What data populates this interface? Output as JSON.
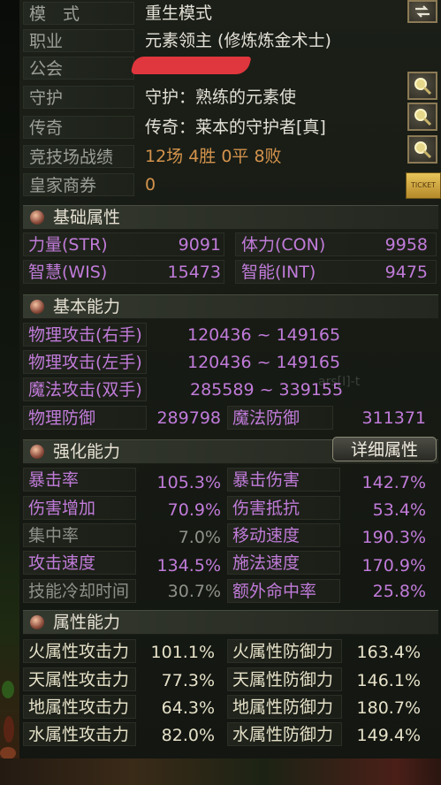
{
  "colors": {
    "label": "#9c9f97",
    "value": "#e3e0d6",
    "orange": "#d4934c",
    "purple": "#c07bd9",
    "header_bg": "#2f342b"
  },
  "info": {
    "rows": [
      {
        "label": "模　式",
        "value": "重生模式",
        "style": "white"
      },
      {
        "label": "职业",
        "value": "元素领主 (修炼炼金术士)",
        "style": "white"
      },
      {
        "label": "公会",
        "value": "",
        "style": "white"
      },
      {
        "label": "守护",
        "value": "守护：熟练的元素使",
        "style": "white"
      },
      {
        "label": "传奇",
        "value": "传奇：莱本的守护者[真]",
        "style": "white"
      },
      {
        "label": "竞技场战绩",
        "value": "12场 4胜 0平 8败",
        "style": "orange"
      },
      {
        "label": "皇家商券",
        "value": "0",
        "style": "orange"
      }
    ],
    "ticket_text": "TICKET"
  },
  "icons": {
    "mode_toggle": "swap-arrows-icon",
    "inspect": "magnifier-icon",
    "section": "orb-icon"
  },
  "basic_attributes": {
    "title": "基础属性",
    "stats": [
      {
        "name": "力量(STR)",
        "value": "9091"
      },
      {
        "name": "体力(CON)",
        "value": "9958"
      },
      {
        "name": "智慧(WIS)",
        "value": "15473"
      },
      {
        "name": "智能(INT)",
        "value": "9475"
      }
    ]
  },
  "basic_abilities": {
    "title": "基本能力",
    "attacks": [
      {
        "name": "物理攻击(右手)",
        "value": "120436 ~ 149165"
      },
      {
        "name": "物理攻击(左手)",
        "value": "120436 ~ 149165"
      },
      {
        "name": "魔法攻击(双手)",
        "value": "285589 ~ 339155"
      }
    ],
    "defense": [
      {
        "name": "物理防御",
        "value": "289798"
      },
      {
        "name": "魔法防御",
        "value": "311371"
      }
    ],
    "ghost_text": "ars[I]-t"
  },
  "enhance": {
    "title": "强化能力",
    "detail_button": "详细属性",
    "stats": [
      {
        "name": "暴击率",
        "value": "105.3%",
        "name_style": "purple"
      },
      {
        "name": "暴击伤害",
        "value": "142.7%",
        "name_style": "purple"
      },
      {
        "name": "伤害增加",
        "value": "70.9%",
        "name_style": "purple"
      },
      {
        "name": "伤害抵抗",
        "value": "53.4%",
        "name_style": "purple"
      },
      {
        "name": "集中率",
        "value": "7.0%",
        "name_style": "gray"
      },
      {
        "name": "移动速度",
        "value": "190.3%",
        "name_style": "purple"
      },
      {
        "name": "攻击速度",
        "value": "134.5%",
        "name_style": "purple"
      },
      {
        "name": "施法速度",
        "value": "170.9%",
        "name_style": "purple"
      },
      {
        "name": "技能冷却时间",
        "value": "30.7%",
        "name_style": "gray"
      },
      {
        "name": "额外命中率",
        "value": "25.8%",
        "name_style": "purple"
      }
    ]
  },
  "element": {
    "title": "属性能力",
    "stats": [
      {
        "name": "火属性攻击力",
        "value": "101.1%"
      },
      {
        "name": "火属性防御力",
        "value": "163.4%"
      },
      {
        "name": "天属性攻击力",
        "value": "77.3%"
      },
      {
        "name": "天属性防御力",
        "value": "146.1%"
      },
      {
        "name": "地属性攻击力",
        "value": "64.3%"
      },
      {
        "name": "地属性防御力",
        "value": "180.7%"
      },
      {
        "name": "水属性攻击力",
        "value": "82.0%"
      },
      {
        "name": "水属性防御力",
        "value": "149.4%"
      }
    ]
  }
}
